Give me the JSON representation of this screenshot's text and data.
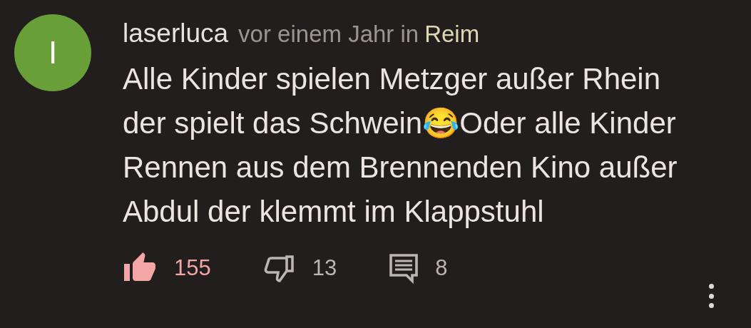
{
  "comment": {
    "avatar_letter": "I",
    "author": "laserluca",
    "meta": "vor einem Jahr in",
    "channel": "Reim",
    "body_lines": [
      "Alle Kinder spielen Metzger außer Rhein",
      "der spielt das Schwein😂Oder alle Kinder",
      "Rennen aus dem Brennenden Kino außer",
      "Abdul der klemmt im Klappstuhl"
    ],
    "actions": [
      {
        "kind": "like",
        "count": "155",
        "selected": true
      },
      {
        "kind": "dislike",
        "count": "13",
        "selected": false
      },
      {
        "kind": "replies",
        "count": "8"
      }
    ]
  }
}
